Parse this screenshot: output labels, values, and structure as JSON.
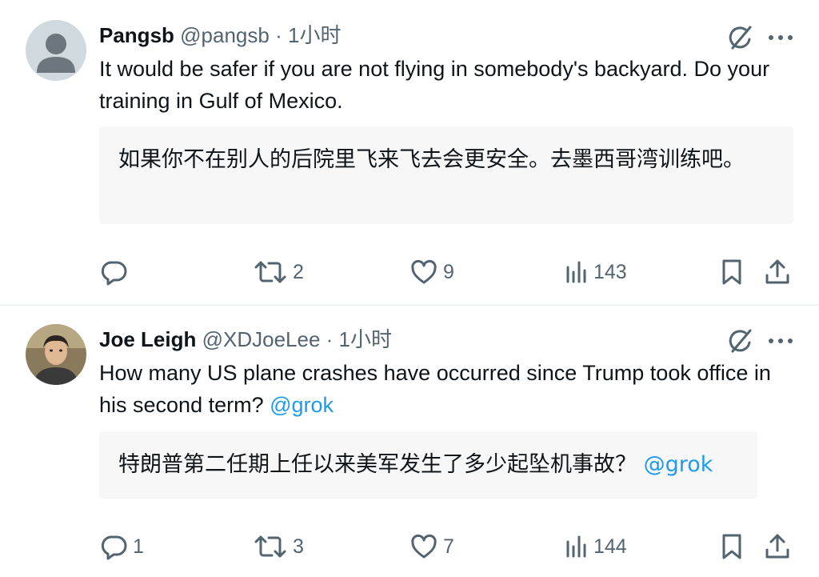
{
  "tweets": [
    {
      "name": "Pangsb",
      "handle": "@pangsb",
      "separator": "·",
      "time": "1小时",
      "text": "It would be safer if you are not flying in somebody's backyard. Do your training in Gulf of Mexico.",
      "mention": "",
      "translation": "如果你不在别人的后院里飞来飞去会更安全。去墨西哥湾训练吧。",
      "translation_mention": "",
      "replies": "",
      "retweets": "2",
      "likes": "9",
      "views": "143"
    },
    {
      "name": "Joe Leigh",
      "handle": "@XDJoeLee",
      "separator": "·",
      "time": "1小时",
      "text": "How many US plane crashes have occurred since Trump took office in his second term? ",
      "mention": "@grok",
      "translation": "特朗普第二任期上任以来美军发生了多少起坠机事故？ ",
      "translation_mention": "@grok",
      "replies": "1",
      "retweets": "3",
      "likes": "7",
      "views": "144"
    }
  ],
  "icons": {
    "grok": "grok-icon",
    "more": "more-icon",
    "reply": "reply-icon",
    "retweet": "retweet-icon",
    "like": "heart-icon",
    "views": "views-icon",
    "bookmark": "bookmark-icon",
    "share": "share-icon"
  },
  "colors": {
    "text": "#0f1419",
    "secondary": "#536471",
    "link": "#1d9bf0",
    "translation_bg": "#f7f7f7",
    "divider": "#eff3f4"
  }
}
